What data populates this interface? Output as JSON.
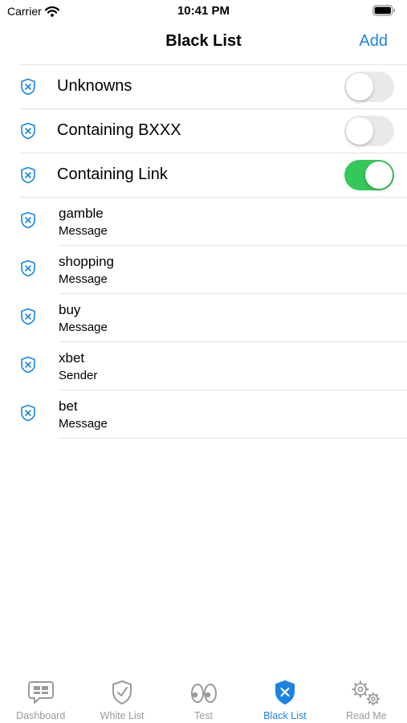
{
  "status_bar": {
    "carrier": "Carrier",
    "time": "10:41 PM"
  },
  "nav": {
    "title": "Black List",
    "add_label": "Add"
  },
  "toggle_rules": [
    {
      "label": "Unknowns",
      "enabled": false
    },
    {
      "label": "Containing BXXX",
      "enabled": false
    },
    {
      "label": "Containing Link",
      "enabled": true
    }
  ],
  "keywords": [
    {
      "word": "gamble",
      "type": "Message"
    },
    {
      "word": "shopping",
      "type": "Message"
    },
    {
      "word": "buy",
      "type": "Message"
    },
    {
      "word": "xbet",
      "type": "Sender"
    },
    {
      "word": "bet",
      "type": "Message"
    }
  ],
  "tabs": [
    {
      "label": "Dashboard",
      "icon": "dashboard-icon",
      "active": false
    },
    {
      "label": "White List",
      "icon": "shield-check-icon",
      "active": false
    },
    {
      "label": "Test",
      "icon": "eyes-icon",
      "active": false
    },
    {
      "label": "Black List",
      "icon": "shield-x-icon",
      "active": true
    },
    {
      "label": "Read Me",
      "icon": "gears-icon",
      "active": false
    }
  ],
  "colors": {
    "accent": "#1a84e3",
    "toggle_on": "#34c759",
    "toggle_off": "#e9e9ea",
    "inactive_tab": "#9a9a9a"
  }
}
